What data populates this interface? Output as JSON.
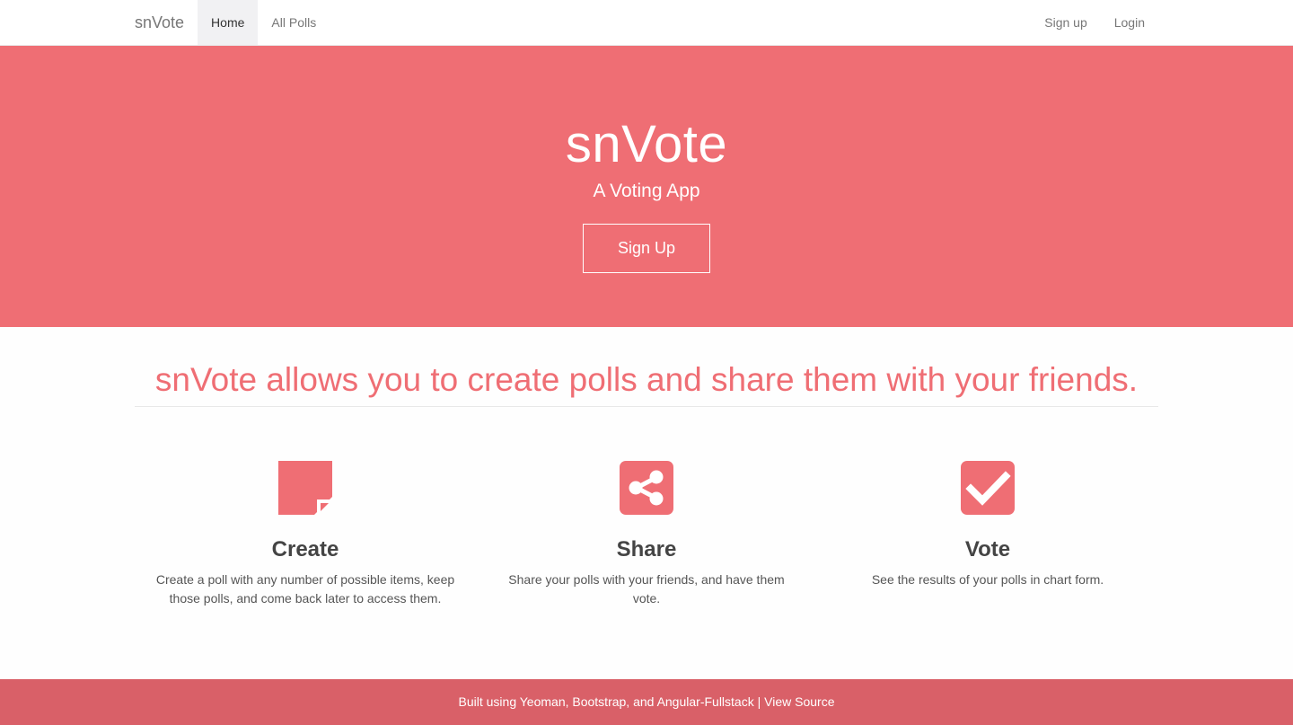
{
  "nav": {
    "brand": "snVote",
    "items": [
      {
        "label": "Home",
        "active": true
      },
      {
        "label": "All Polls",
        "active": false
      }
    ],
    "right_items": [
      {
        "label": "Sign up"
      },
      {
        "label": "Login"
      }
    ]
  },
  "hero": {
    "title": "snVote",
    "subtitle": "A Voting App",
    "button_label": "Sign Up"
  },
  "tagline": "snVote allows you to create polls and share them with your friends.",
  "features": [
    {
      "icon": "sticky-note-icon",
      "title": "Create",
      "description": "Create a poll with any number of possible items, keep those polls, and come back later to access them."
    },
    {
      "icon": "share-icon",
      "title": "Share",
      "description": "Share your polls with your friends, and have them vote."
    },
    {
      "icon": "check-square-icon",
      "title": "Vote",
      "description": "See the results of your polls in chart form."
    }
  ],
  "footer": {
    "text": "Built using Yeoman, Bootstrap, and Angular-Fullstack",
    "separator": " | ",
    "link_label": "View Source"
  },
  "colors": {
    "accent": "#ef6e74",
    "footer": "#d96068"
  }
}
